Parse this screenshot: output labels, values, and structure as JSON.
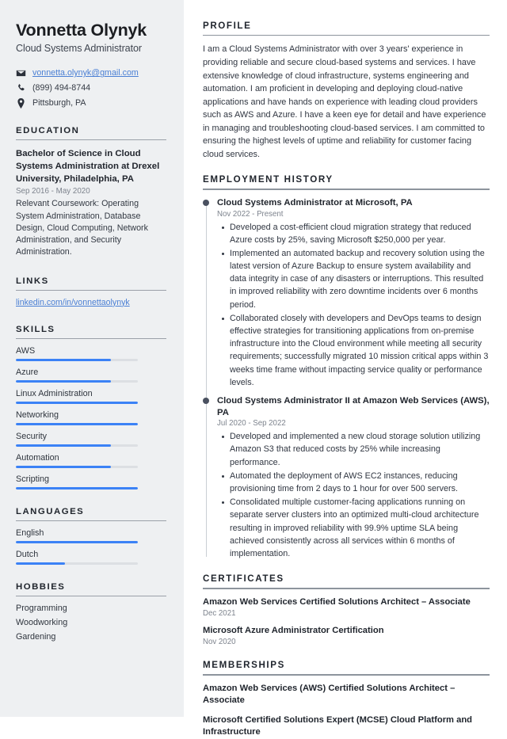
{
  "sidebar": {
    "name": "Vonnetta Olynyk",
    "job_title": "Cloud Systems Administrator",
    "contact": {
      "email": "vonnetta.olynyk@gmail.com",
      "phone": "(899) 494-8744",
      "location": "Pittsburgh, PA"
    },
    "education": {
      "title": "EDUCATION",
      "degree": "Bachelor of Science in Cloud Systems Administration at Drexel University, Philadelphia, PA",
      "date": "Sep 2016 - May 2020",
      "description": "Relevant Coursework: Operating System Administration, Database Design, Cloud Computing, Network Administration, and Security Administration."
    },
    "links": {
      "title": "LINKS",
      "items": [
        {
          "label": "linkedin.com/in/vonnettaolynyk"
        }
      ]
    },
    "skills": {
      "title": "SKILLS",
      "items": [
        {
          "label": "AWS",
          "level": 78
        },
        {
          "label": "Azure",
          "level": 78
        },
        {
          "label": "Linux Administration",
          "level": 100
        },
        {
          "label": "Networking",
          "level": 100
        },
        {
          "label": "Security",
          "level": 78
        },
        {
          "label": "Automation",
          "level": 78
        },
        {
          "label": "Scripting",
          "level": 100
        }
      ]
    },
    "languages": {
      "title": "LANGUAGES",
      "items": [
        {
          "label": "English",
          "level": 100
        },
        {
          "label": "Dutch",
          "level": 40
        }
      ]
    },
    "hobbies": {
      "title": "HOBBIES",
      "items": [
        {
          "label": "Programming"
        },
        {
          "label": "Woodworking"
        },
        {
          "label": "Gardening"
        }
      ]
    }
  },
  "main": {
    "profile": {
      "title": "PROFILE",
      "text": "I am a Cloud Systems Administrator with over 3 years' experience in providing reliable and secure cloud-based systems and services. I have extensive knowledge of cloud infrastructure, systems engineering and automation. I am proficient in developing and deploying cloud-native applications and have hands on experience with leading cloud providers such as AWS and Azure. I have a keen eye for detail and have experience in managing and troubleshooting cloud-based services. I am committed to ensuring the highest levels of uptime and reliability for customer facing cloud services."
    },
    "employment": {
      "title": "EMPLOYMENT HISTORY",
      "jobs": [
        {
          "heading": "Cloud Systems Administrator at Microsoft, PA",
          "date": "Nov 2022 - Present",
          "bullets": [
            "Developed a cost-efficient cloud migration strategy that reduced Azure costs by 25%, saving Microsoft $250,000 per year.",
            "Implemented an automated backup and recovery solution using the latest version of Azure Backup to ensure system availability and data integrity in case of any disasters or interruptions. This resulted in improved reliability with zero downtime incidents over 6 months period.",
            "Collaborated closely with developers and DevOps teams to design effective strategies for transitioning applications from on-premise infrastructure into the Cloud environment while meeting all security requirements; successfully migrated 10 mission critical apps within 3 weeks time frame without impacting service quality or performance levels."
          ]
        },
        {
          "heading": "Cloud Systems Administrator II at Amazon Web Services (AWS), PA",
          "date": "Jul 2020 - Sep 2022",
          "bullets": [
            "Developed and implemented a new cloud storage solution utilizing Amazon S3 that reduced costs by 25% while increasing performance.",
            "Automated the deployment of AWS EC2 instances, reducing provisioning time from 2 days to 1 hour for over 500 servers.",
            "Consolidated multiple customer-facing applications running on separate server clusters into an optimized multi-cloud architecture resulting in improved reliability with 99.9% uptime SLA being achieved consistently across all services within 6 months of implementation."
          ]
        }
      ]
    },
    "certificates": {
      "title": "CERTIFICATES",
      "items": [
        {
          "name": "Amazon Web Services Certified Solutions Architect – Associate",
          "date": "Dec 2021"
        },
        {
          "name": "Microsoft Azure Administrator Certification",
          "date": "Nov 2020"
        }
      ]
    },
    "memberships": {
      "title": "MEMBERSHIPS",
      "items": [
        {
          "name": "Amazon Web Services (AWS) Certified Solutions Architect – Associate"
        },
        {
          "name": "Microsoft Certified Solutions Expert (MCSE) Cloud Platform and Infrastructure"
        }
      ]
    }
  },
  "colors": {
    "accent": "#3b82f6",
    "link": "#4a7fd4",
    "sidebar_bg": "#eef0f2",
    "heading": "#1f242c",
    "muted": "#7d838d"
  }
}
